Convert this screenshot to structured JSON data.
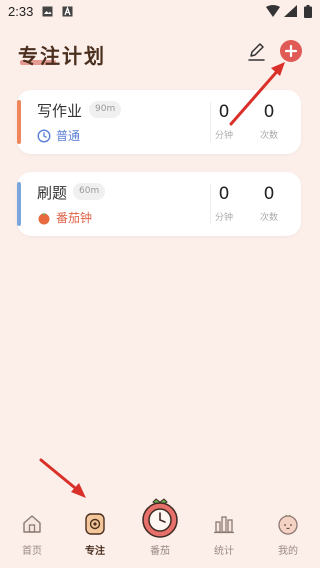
{
  "status_bar": {
    "time": "2:33"
  },
  "header": {
    "title": "专注计划"
  },
  "plans": [
    {
      "title": "写作业",
      "duration": "90m",
      "mode": "普通",
      "minutes_value": "0",
      "minutes_label": "分钟",
      "count_value": "0",
      "count_label": "次数",
      "accent_color": "#F0865E",
      "mode_color": "#5B7FD6"
    },
    {
      "title": "刷题",
      "duration": "60m",
      "mode": "番茄钟",
      "minutes_value": "0",
      "minutes_label": "分钟",
      "count_value": "0",
      "count_label": "次数",
      "accent_color": "#7BA7DC",
      "mode_color": "#E0654A"
    }
  ],
  "tabs": [
    {
      "label": "首页",
      "icon": "home-icon"
    },
    {
      "label": "专注",
      "icon": "focus-icon",
      "active": true
    },
    {
      "label": "番茄",
      "icon": "tomato-clock-icon"
    },
    {
      "label": "统计",
      "icon": "statistics-icon"
    },
    {
      "label": "我的",
      "icon": "profile-icon"
    }
  ],
  "colors": {
    "background": "#FCEEE9",
    "accent_red": "#E05A56",
    "title_brown": "#4A2E1E"
  }
}
